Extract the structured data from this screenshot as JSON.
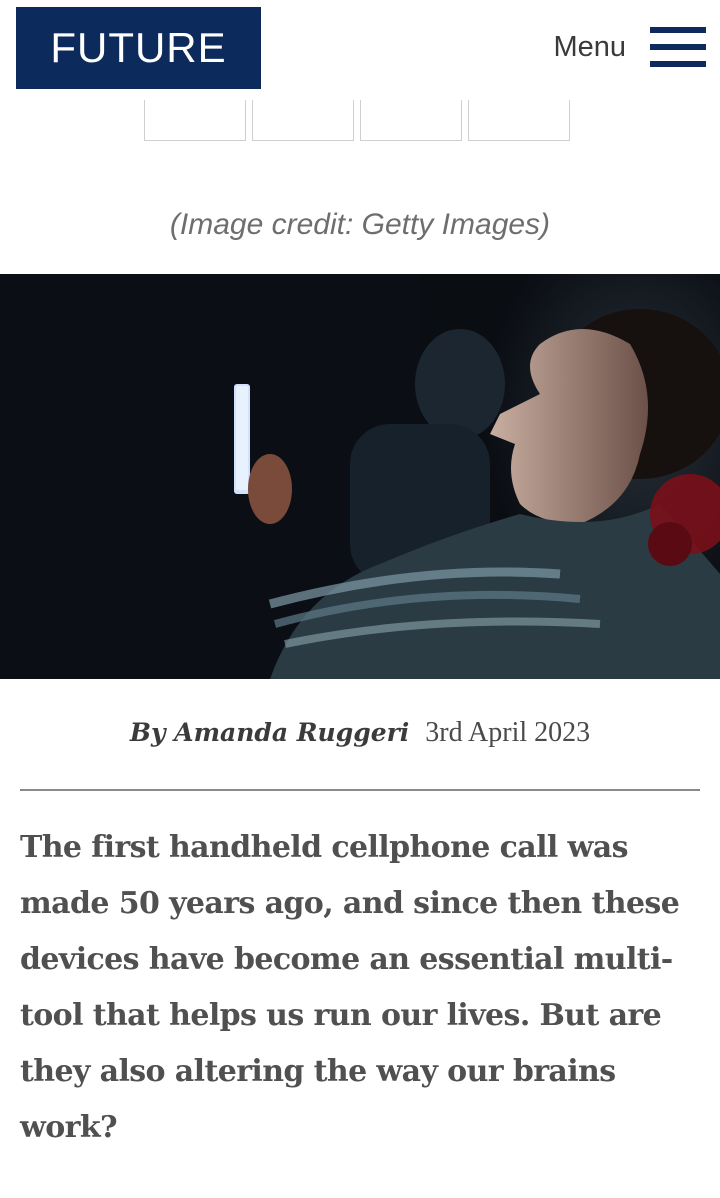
{
  "header": {
    "logo_text": "FUTURE",
    "menu_label": "Menu"
  },
  "share": {
    "buttons": [
      "share-button-1",
      "share-button-2",
      "share-button-3",
      "share-button-4"
    ]
  },
  "image": {
    "credit": "(Image credit: Getty Images)",
    "subject": "woman lying in the dark lit by smartphone screen"
  },
  "article": {
    "author": "By Amanda Ruggeri",
    "date": "3rd April 2023",
    "summary": "The first handheld cellphone call was made 50 years ago, and since then these devices have become an essential multi-tool that helps us run our lives. But are they also altering the way our brains work?"
  },
  "colors": {
    "brand": "#0d2a5c",
    "text": "#505050",
    "divider": "#8a8a8a"
  }
}
